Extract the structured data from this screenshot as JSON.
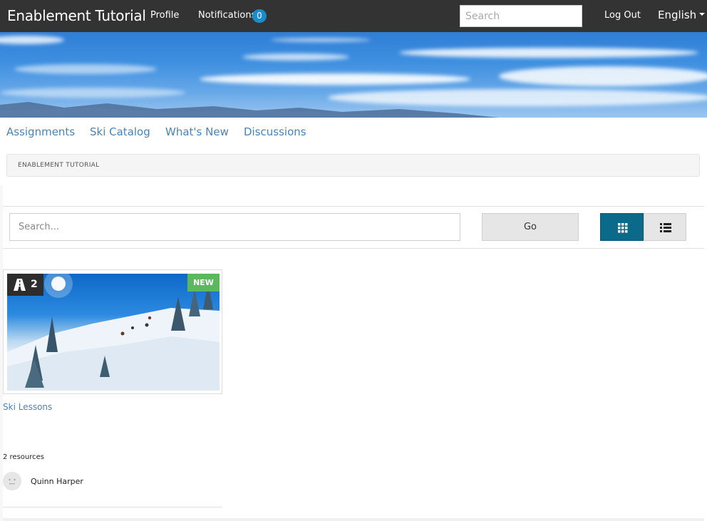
{
  "header": {
    "brand": "Enablement Tutorial",
    "profile_label": "Profile",
    "notifications_label": "Notifications",
    "notifications_count": "0",
    "search_placeholder": "Search",
    "logout_label": "Log Out",
    "language_label": "English"
  },
  "subnav": {
    "items": [
      "Assignments",
      "Ski Catalog",
      "What's New",
      "Discussions"
    ]
  },
  "breadcrumb": {
    "label": "ENABLEMENT TUTORIAL"
  },
  "filter": {
    "search_placeholder": "Search...",
    "go_label": "Go",
    "view_grid_icon": "grid-icon",
    "view_list_icon": "list-icon"
  },
  "card": {
    "count": "2",
    "count_icon": "road-icon",
    "new_badge": "NEW",
    "title": "Ski Lessons",
    "resources": "2 resources",
    "author": "Quinn Harper"
  },
  "colors": {
    "topbar": "#333333",
    "link": "#4a83b8",
    "grid_active": "#0b6a8a",
    "new_badge": "#5cb85c",
    "notif_badge": "#1a8ccc"
  }
}
